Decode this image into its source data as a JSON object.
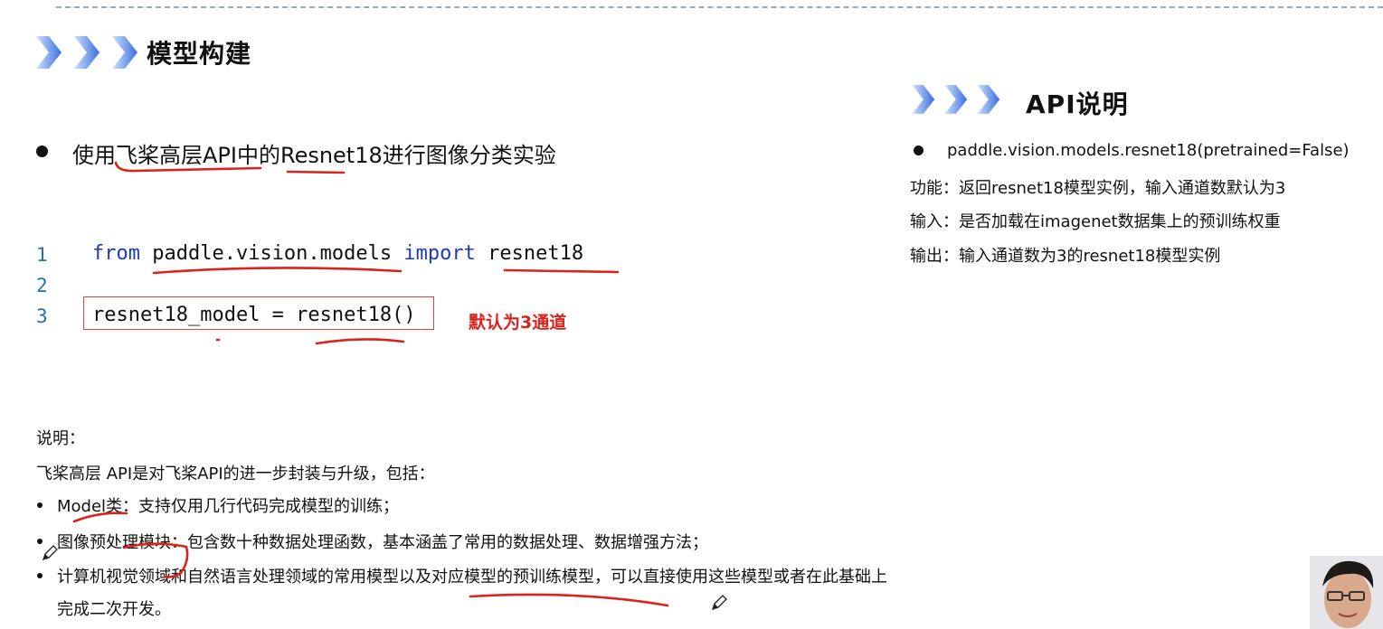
{
  "model_section": {
    "title": "模型构建",
    "bullet": "使用飞桨高层API中的Resnet18进行图像分类实验"
  },
  "code": {
    "line_numbers": [
      "1",
      "2",
      "3"
    ],
    "line1": {
      "kw_from": "from",
      "module": "paddle.vision.models",
      "kw_import": "import",
      "name": "resnet18"
    },
    "line3": "resnet18_model = resnet18()",
    "annotation": "默认为3通道"
  },
  "api_section": {
    "title": "API说明",
    "signature": "paddle.vision.models.resnet18(pretrained=False)",
    "function": "功能：返回resnet18模型实例，输入通道数默认为3",
    "input": "输入：是否加载在imagenet数据集上的预训练权重",
    "output": "输出：输入通道数为3的resnet18模型实例"
  },
  "notes": {
    "heading": "说明：",
    "intro": "飞桨高层 API是对飞桨API的进一步封装与升级，包括：",
    "items": [
      "Model类：支持仅用几行代码完成模型的训练；",
      "图像预处理模块：包含数十种数据处理函数，基本涵盖了常用的数据处理、数据增强方法；",
      "计算机视觉领域和自然语言处理领域的常用模型以及对应模型的预训练模型，可以直接使用这些模型或者在此基础上"
    ],
    "item3_cont": "完成二次开发。"
  },
  "colors": {
    "chevron": "#3a6fe0",
    "annotation_red": "#d9231c",
    "code_keyword": "#1b38c8",
    "line_number": "#2a6f9e"
  },
  "icons": [
    "chevron-right-icon",
    "pen-cursor-icon"
  ]
}
